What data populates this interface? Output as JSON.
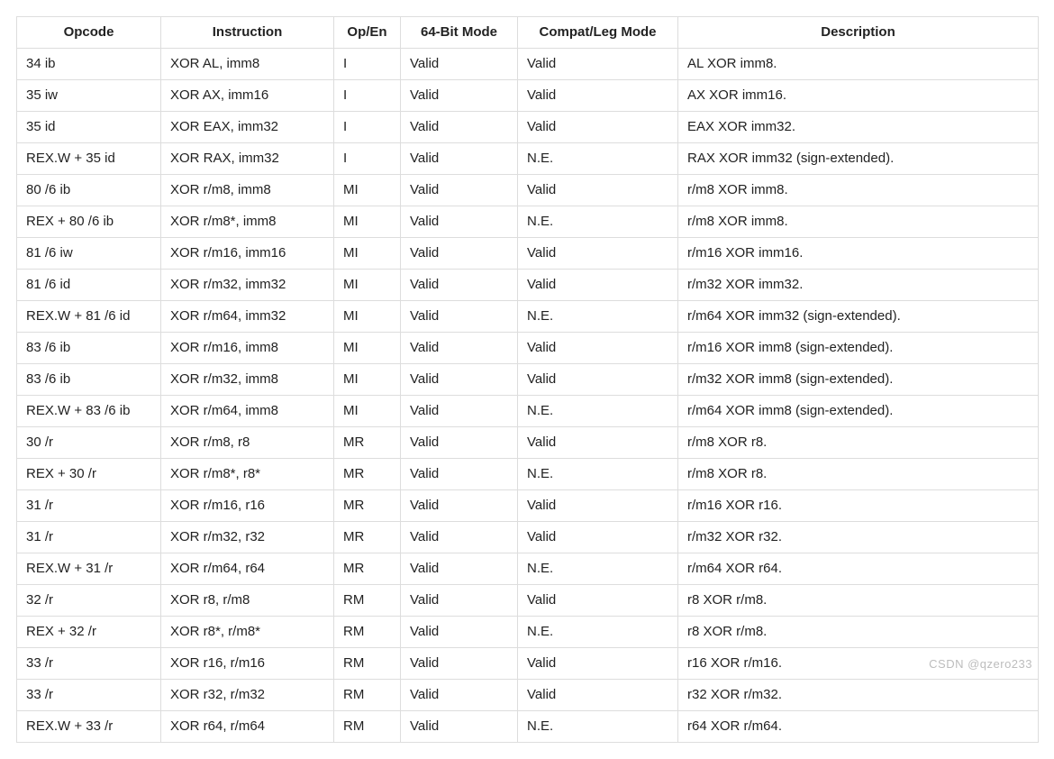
{
  "watermark": "CSDN @qzero233",
  "columns": [
    "Opcode",
    "Instruction",
    "Op/En",
    "64-Bit Mode",
    "Compat/Leg Mode",
    "Description"
  ],
  "rows": [
    {
      "opcode": "34 ib",
      "instruction": "XOR AL, imm8",
      "opEn": "I",
      "mode64": "Valid",
      "compat": "Valid",
      "description": "AL XOR imm8."
    },
    {
      "opcode": "35 iw",
      "instruction": "XOR AX, imm16",
      "opEn": "I",
      "mode64": "Valid",
      "compat": "Valid",
      "description": "AX XOR imm16."
    },
    {
      "opcode": "35 id",
      "instruction": "XOR EAX, imm32",
      "opEn": "I",
      "mode64": "Valid",
      "compat": "Valid",
      "description": "EAX XOR imm32."
    },
    {
      "opcode": "REX.W + 35 id",
      "instruction": "XOR RAX, imm32",
      "opEn": "I",
      "mode64": "Valid",
      "compat": "N.E.",
      "description": "RAX XOR imm32 (sign-extended)."
    },
    {
      "opcode": "80 /6 ib",
      "instruction": "XOR r/m8, imm8",
      "opEn": "MI",
      "mode64": "Valid",
      "compat": "Valid",
      "description": "r/m8 XOR imm8."
    },
    {
      "opcode": "REX + 80 /6 ib",
      "instruction": "XOR r/m8*, imm8",
      "opEn": "MI",
      "mode64": "Valid",
      "compat": "N.E.",
      "description": "r/m8 XOR imm8."
    },
    {
      "opcode": "81 /6 iw",
      "instruction": "XOR r/m16, imm16",
      "opEn": "MI",
      "mode64": "Valid",
      "compat": "Valid",
      "description": "r/m16 XOR imm16."
    },
    {
      "opcode": "81 /6 id",
      "instruction": "XOR r/m32, imm32",
      "opEn": "MI",
      "mode64": "Valid",
      "compat": "Valid",
      "description": "r/m32 XOR imm32."
    },
    {
      "opcode": "REX.W + 81 /6 id",
      "instruction": "XOR r/m64, imm32",
      "opEn": "MI",
      "mode64": "Valid",
      "compat": "N.E.",
      "description": "r/m64 XOR imm32 (sign-extended)."
    },
    {
      "opcode": "83 /6 ib",
      "instruction": "XOR r/m16, imm8",
      "opEn": "MI",
      "mode64": "Valid",
      "compat": "Valid",
      "description": "r/m16 XOR imm8 (sign-extended)."
    },
    {
      "opcode": "83 /6 ib",
      "instruction": "XOR r/m32, imm8",
      "opEn": "MI",
      "mode64": "Valid",
      "compat": "Valid",
      "description": "r/m32 XOR imm8 (sign-extended)."
    },
    {
      "opcode": "REX.W + 83 /6 ib",
      "instruction": "XOR r/m64, imm8",
      "opEn": "MI",
      "mode64": "Valid",
      "compat": "N.E.",
      "description": "r/m64 XOR imm8 (sign-extended)."
    },
    {
      "opcode": "30 /r",
      "instruction": "XOR r/m8, r8",
      "opEn": "MR",
      "mode64": "Valid",
      "compat": "Valid",
      "description": "r/m8 XOR r8."
    },
    {
      "opcode": "REX + 30 /r",
      "instruction": "XOR r/m8*, r8*",
      "opEn": "MR",
      "mode64": "Valid",
      "compat": "N.E.",
      "description": "r/m8 XOR r8."
    },
    {
      "opcode": "31 /r",
      "instruction": "XOR r/m16, r16",
      "opEn": "MR",
      "mode64": "Valid",
      "compat": "Valid",
      "description": "r/m16 XOR r16."
    },
    {
      "opcode": "31 /r",
      "instruction": "XOR r/m32, r32",
      "opEn": "MR",
      "mode64": "Valid",
      "compat": "Valid",
      "description": "r/m32 XOR r32."
    },
    {
      "opcode": "REX.W + 31 /r",
      "instruction": "XOR r/m64, r64",
      "opEn": "MR",
      "mode64": "Valid",
      "compat": "N.E.",
      "description": "r/m64 XOR r64."
    },
    {
      "opcode": "32 /r",
      "instruction": "XOR r8, r/m8",
      "opEn": "RM",
      "mode64": "Valid",
      "compat": "Valid",
      "description": "r8 XOR r/m8."
    },
    {
      "opcode": "REX + 32 /r",
      "instruction": "XOR r8*, r/m8*",
      "opEn": "RM",
      "mode64": "Valid",
      "compat": "N.E.",
      "description": "r8 XOR r/m8."
    },
    {
      "opcode": "33 /r",
      "instruction": "XOR r16, r/m16",
      "opEn": "RM",
      "mode64": "Valid",
      "compat": "Valid",
      "description": "r16 XOR r/m16."
    },
    {
      "opcode": "33 /r",
      "instruction": "XOR r32, r/m32",
      "opEn": "RM",
      "mode64": "Valid",
      "compat": "Valid",
      "description": "r32 XOR r/m32."
    },
    {
      "opcode": "REX.W + 33 /r",
      "instruction": "XOR r64, r/m64",
      "opEn": "RM",
      "mode64": "Valid",
      "compat": "N.E.",
      "description": "r64 XOR r/m64."
    }
  ]
}
